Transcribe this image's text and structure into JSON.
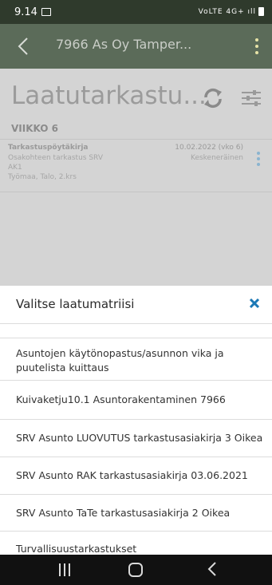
{
  "status_bar": {
    "time": "9.14",
    "network": "VoLTE 4G+ ıll"
  },
  "app_bar": {
    "back_icon": "arrow-left",
    "title": "7966 As Oy Tamper...",
    "menu_icon": "vertical-dots"
  },
  "page": {
    "title": "Laatutarkastu...",
    "refresh_icon": "refresh-icon",
    "filter_icon": "sliders-icon",
    "week_label": "VIIKKO 6"
  },
  "inspection_card": {
    "title": "Tarkastuspöytäkirja",
    "line1": "Osakohteen tarkastus SRV",
    "line2": "AK1",
    "line3": "Työmaa, Talo, 2.krs",
    "date": "10.02.2022 (vko 6)",
    "status": "Keskeneräinen"
  },
  "sheet": {
    "title": "Valitse laatumatriisi",
    "close_icon": "close-icon",
    "options": [
      "Asuntojen käytönopastus/asunnon vika ja puutelista kuittaus",
      "Kuivaketju10.1 Asuntorakentaminen 7966",
      "SRV Asunto LUOVUTUS tarkastusasiakirja 3 Oikea",
      "SRV Asunto RAK tarkastusasiakirja 03.06.2021",
      "SRV Asunto TaTe tarkastusasiakirja 2 Oikea",
      "Turvallisuustarkastukset"
    ]
  },
  "nav_bar": {
    "recent_icon": "recent-apps",
    "home_icon": "home",
    "back_icon": "back"
  },
  "colors": {
    "app_bar": "#5b6b59",
    "accent": "#1b78b5",
    "overlay": "#d4d4d4"
  }
}
